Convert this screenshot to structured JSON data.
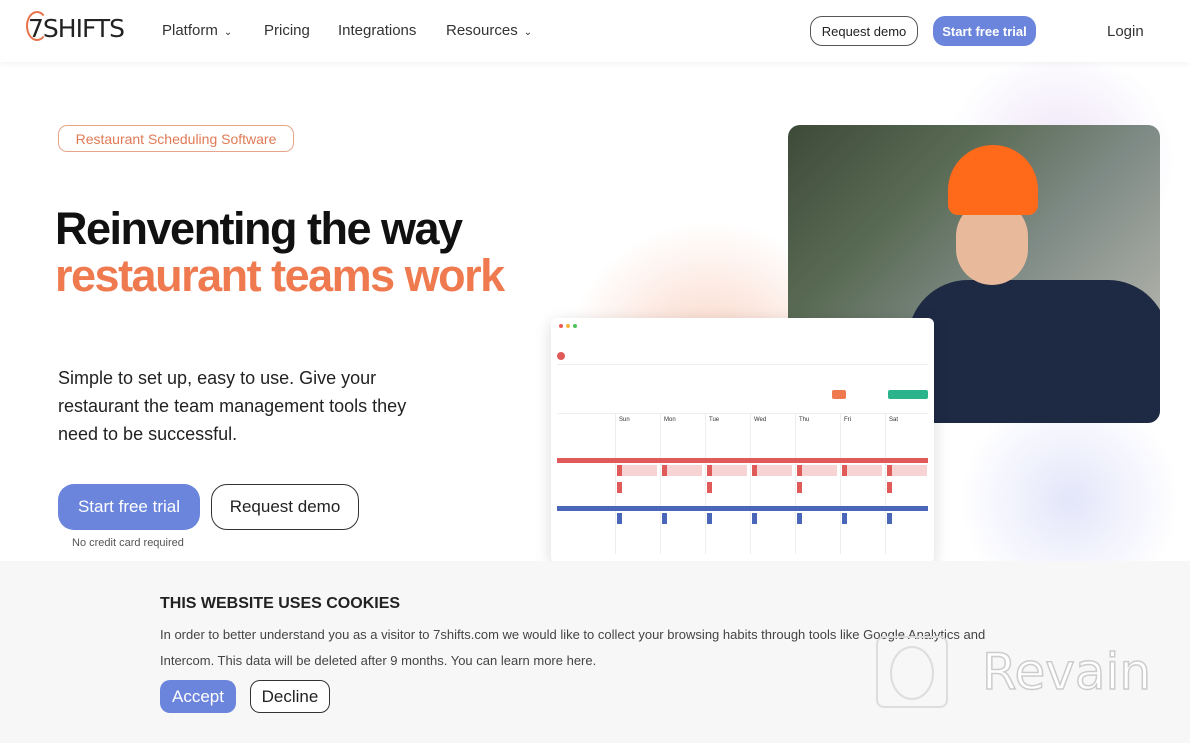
{
  "nav": {
    "logo": "7SHIFTS",
    "links": [
      {
        "label": "Platform",
        "dropdown": true
      },
      {
        "label": "Pricing",
        "dropdown": false
      },
      {
        "label": "Integrations",
        "dropdown": false
      },
      {
        "label": "Resources",
        "dropdown": true
      }
    ],
    "request_demo": "Request demo",
    "start_trial": "Start free trial",
    "login": "Login"
  },
  "hero": {
    "tag": "Restaurant Scheduling Software",
    "title_line1": "Reinventing the way",
    "title_line2": "restaurant teams work",
    "subtitle": "Simple to set up, easy to use. Give your restaurant the team management tools they need to be successful.",
    "cta_primary": "Start free trial",
    "cta_secondary": "Request demo",
    "note": "No credit card required"
  },
  "mockup": {
    "days": [
      "Sun",
      "Mon",
      "Tue",
      "Wed",
      "Thu",
      "Fri",
      "Sat"
    ]
  },
  "cookie": {
    "title": "THIS WEBSITE USES COOKIES",
    "text": "In order to better understand you as a visitor to 7shifts.com we would like to collect your browsing habits through tools like Google Analytics and Intercom. This data will be deleted after 9 months. You can learn more here.",
    "accept": "Accept",
    "decline": "Decline"
  },
  "watermark": "Revain",
  "colors": {
    "accent": "#6b85dc",
    "brand_orange": "#ef7a50",
    "publish_green": "#2bb38b",
    "red_band": "#e05a5a",
    "blue_band": "#4a66b8"
  }
}
